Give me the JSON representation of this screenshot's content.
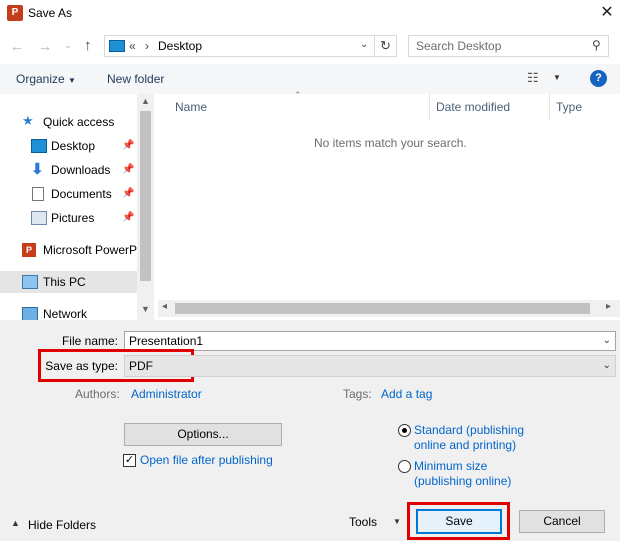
{
  "window": {
    "title": "Save As",
    "app_icon": "P"
  },
  "address": {
    "overflow": "«",
    "separator": "›",
    "location": "Desktop"
  },
  "search": {
    "placeholder": "Search Desktop"
  },
  "toolbar": {
    "organize": "Organize",
    "new_folder": "New folder"
  },
  "sidebar": {
    "items": [
      {
        "label": "Quick access"
      },
      {
        "label": "Desktop"
      },
      {
        "label": "Downloads"
      },
      {
        "label": "Documents"
      },
      {
        "label": "Pictures"
      },
      {
        "label": "Microsoft PowerP"
      },
      {
        "label": "This PC"
      },
      {
        "label": "Network"
      }
    ]
  },
  "columns": {
    "name": "Name",
    "date_modified": "Date modified",
    "type": "Type"
  },
  "empty_message": "No items match your search.",
  "form": {
    "file_name_label": "File name:",
    "file_name_value": "Presentation1",
    "save_type_label": "Save as type:",
    "save_type_value": "PDF",
    "authors_label": "Authors:",
    "authors_value": "Administrator",
    "tags_label": "Tags:",
    "tags_value": "Add a tag"
  },
  "options": {
    "options_button": "Options...",
    "open_after_label": "Open file after publishing",
    "open_after_checked": true,
    "standard_line1": "Standard (publishing",
    "standard_line2": "online and printing)",
    "minimum_line1": "Minimum size",
    "minimum_line2": "(publishing online)",
    "selected_optimization": "standard"
  },
  "footer": {
    "hide_folders": "Hide Folders",
    "tools": "Tools",
    "save": "Save",
    "cancel": "Cancel"
  },
  "colors": {
    "highlight_red": "#e00000",
    "link_blue": "#0066cc",
    "accent": "#0078d7"
  }
}
